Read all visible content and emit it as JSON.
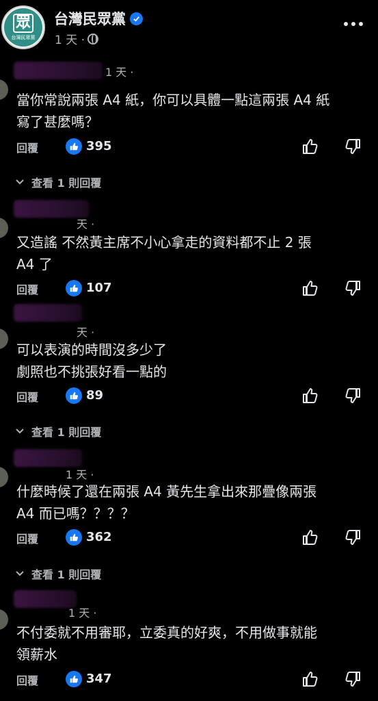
{
  "header": {
    "page_name": "台灣民眾黨",
    "avatar_glyph": "眾",
    "avatar_caption": "台灣民眾黨",
    "post_time": "1 天 ·"
  },
  "comments": [
    {
      "time": "1 天 ·",
      "text": "當你常說兩張 A4 紙，你可以具體一點這兩張 A4 紙\n寫了甚麼嗎？",
      "reply_label": "回覆",
      "likes": "395",
      "view_replies": "查看 1 則回覆"
    },
    {
      "time": "天 ·",
      "text": "又造謠 不然黃主席不小心拿走的資料都不止 2 張\nA4 了",
      "reply_label": "回覆",
      "likes": "107",
      "view_replies": ""
    },
    {
      "time": "天 ·",
      "text": "可以表演的時間沒多少了\n劇照也不挑張好看一點的",
      "reply_label": "回覆",
      "likes": "89",
      "view_replies": "查看 1 則回覆"
    },
    {
      "time": "1 天 ·",
      "text": "什麼時候了還在兩張 A4  黃先生拿出來那疊像兩張\nA4 而已嗎？？？？",
      "reply_label": "回覆",
      "likes": "362",
      "view_replies": "查看 1 則回覆"
    },
    {
      "time": "1 天 ·",
      "text": "不付委就不用審耶，立委真的好爽，不用做事就能\n領薪水",
      "reply_label": "回覆",
      "likes": "347",
      "view_replies": ""
    }
  ],
  "colors": {
    "background": "#000000",
    "text": "#e4e6eb",
    "muted": "#b0b3b8",
    "accent": "#1877f2"
  }
}
